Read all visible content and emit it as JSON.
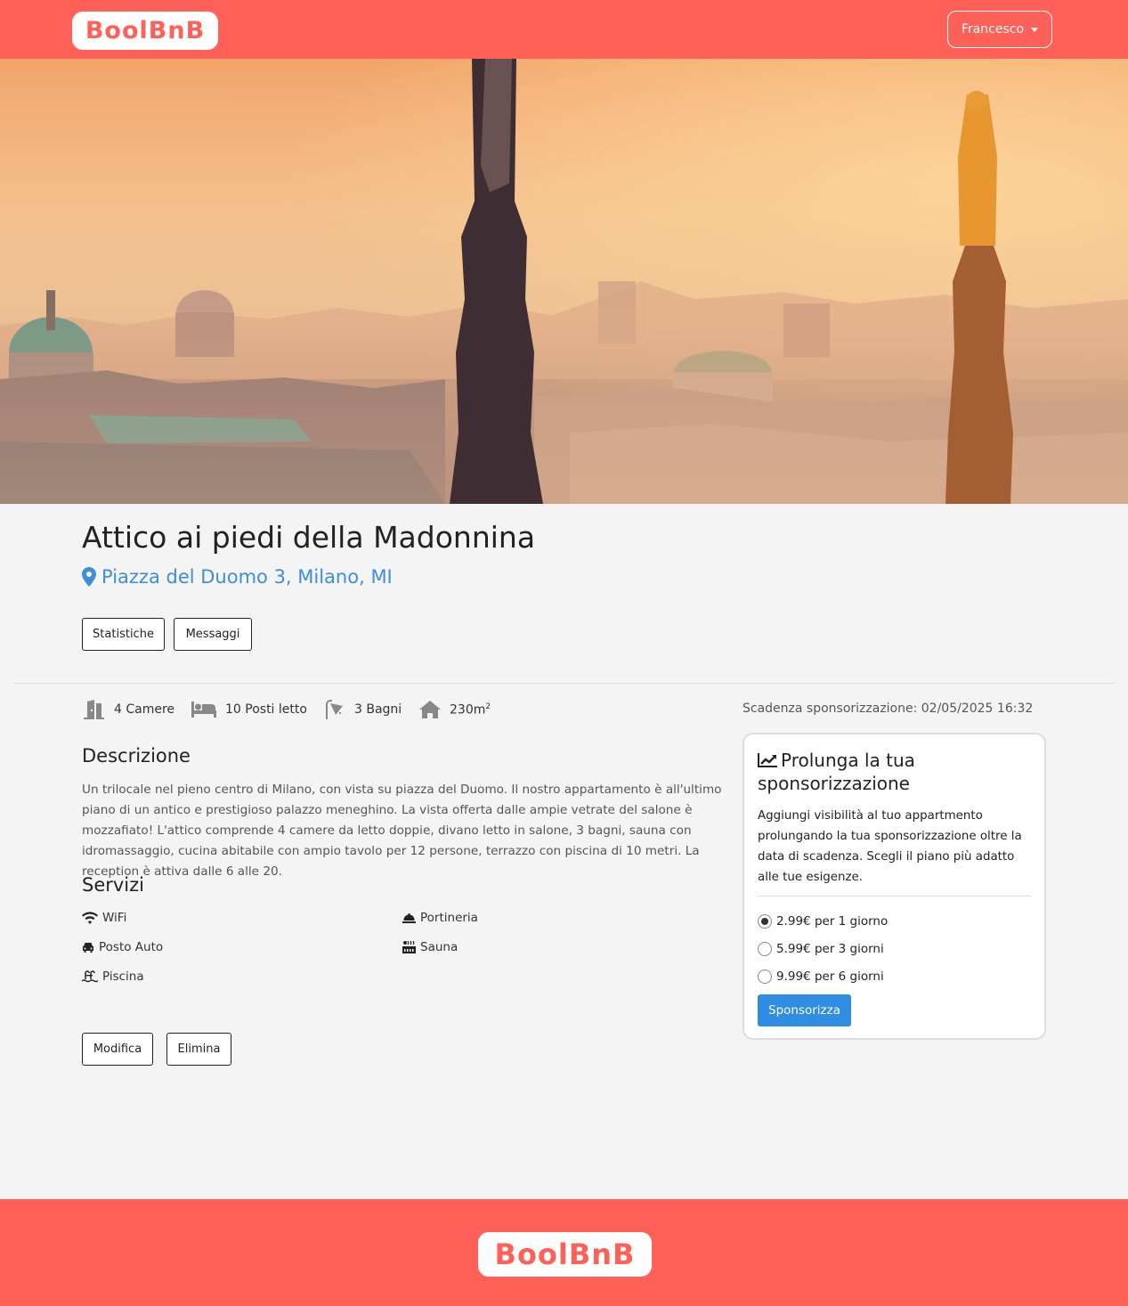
{
  "header": {
    "logo": "BoolBnB",
    "user": "Francesco"
  },
  "apartment": {
    "title": "Attico ai piedi della Madonnina",
    "address": "Piazza del Duomo 3, Milano, MI"
  },
  "actions_top": {
    "stats": "Statistiche",
    "messages": "Messaggi"
  },
  "features": {
    "rooms": "4 Camere",
    "beds": "10 Posti letto",
    "baths": "3 Bagni",
    "size": "230m",
    "size_sup": "2"
  },
  "sponsorship_expiry": "Scadenza sponsorizzazione: 02/05/2025 16:32",
  "description": {
    "heading": "Descrizione",
    "text": "Un trilocale nel pieno centro di Milano, con vista su piazza del Duomo. Il nostro appartamento è all'ultimo piano di un antico e prestigioso palazzo meneghino. La vista offerta dalle ampie vetrate del salone è mozzafiato! L'attico comprende 4 camere da letto doppie, divano letto in salone, 3 bagni, sauna con idromassaggio, cucina abitabile con ampio tavolo per 12 persone, terrazzo con piscina di 10 metri. La reception è attiva dalle 6 alle 20."
  },
  "services": {
    "heading": "Servizi",
    "items": [
      "WiFi",
      "Portineria",
      "Posto Auto",
      "Sauna",
      "Piscina"
    ]
  },
  "actions_bottom": {
    "edit": "Modifica",
    "delete": "Elimina"
  },
  "sponsor_card": {
    "title": "Prolunga la tua sponsorizzazione",
    "text": "Aggiungi visibilità al tuo appartmento prolungando la tua sponsorizzazione oltre la data di scadenza. Scegli il piano più adatto alle tue esigenze.",
    "plans": [
      "2.99€ per 1 giorno",
      "5.99€ per 3 giorni",
      "9.99€ per 6 giorni"
    ],
    "selected_plan": "2.99€ per 1 giorno",
    "button": "Sponsorizza"
  },
  "footer": {
    "logo": "BoolBnB"
  },
  "colors": {
    "brand": "#ff6159",
    "link": "#3c8fd8",
    "button": "#2f8de4"
  }
}
